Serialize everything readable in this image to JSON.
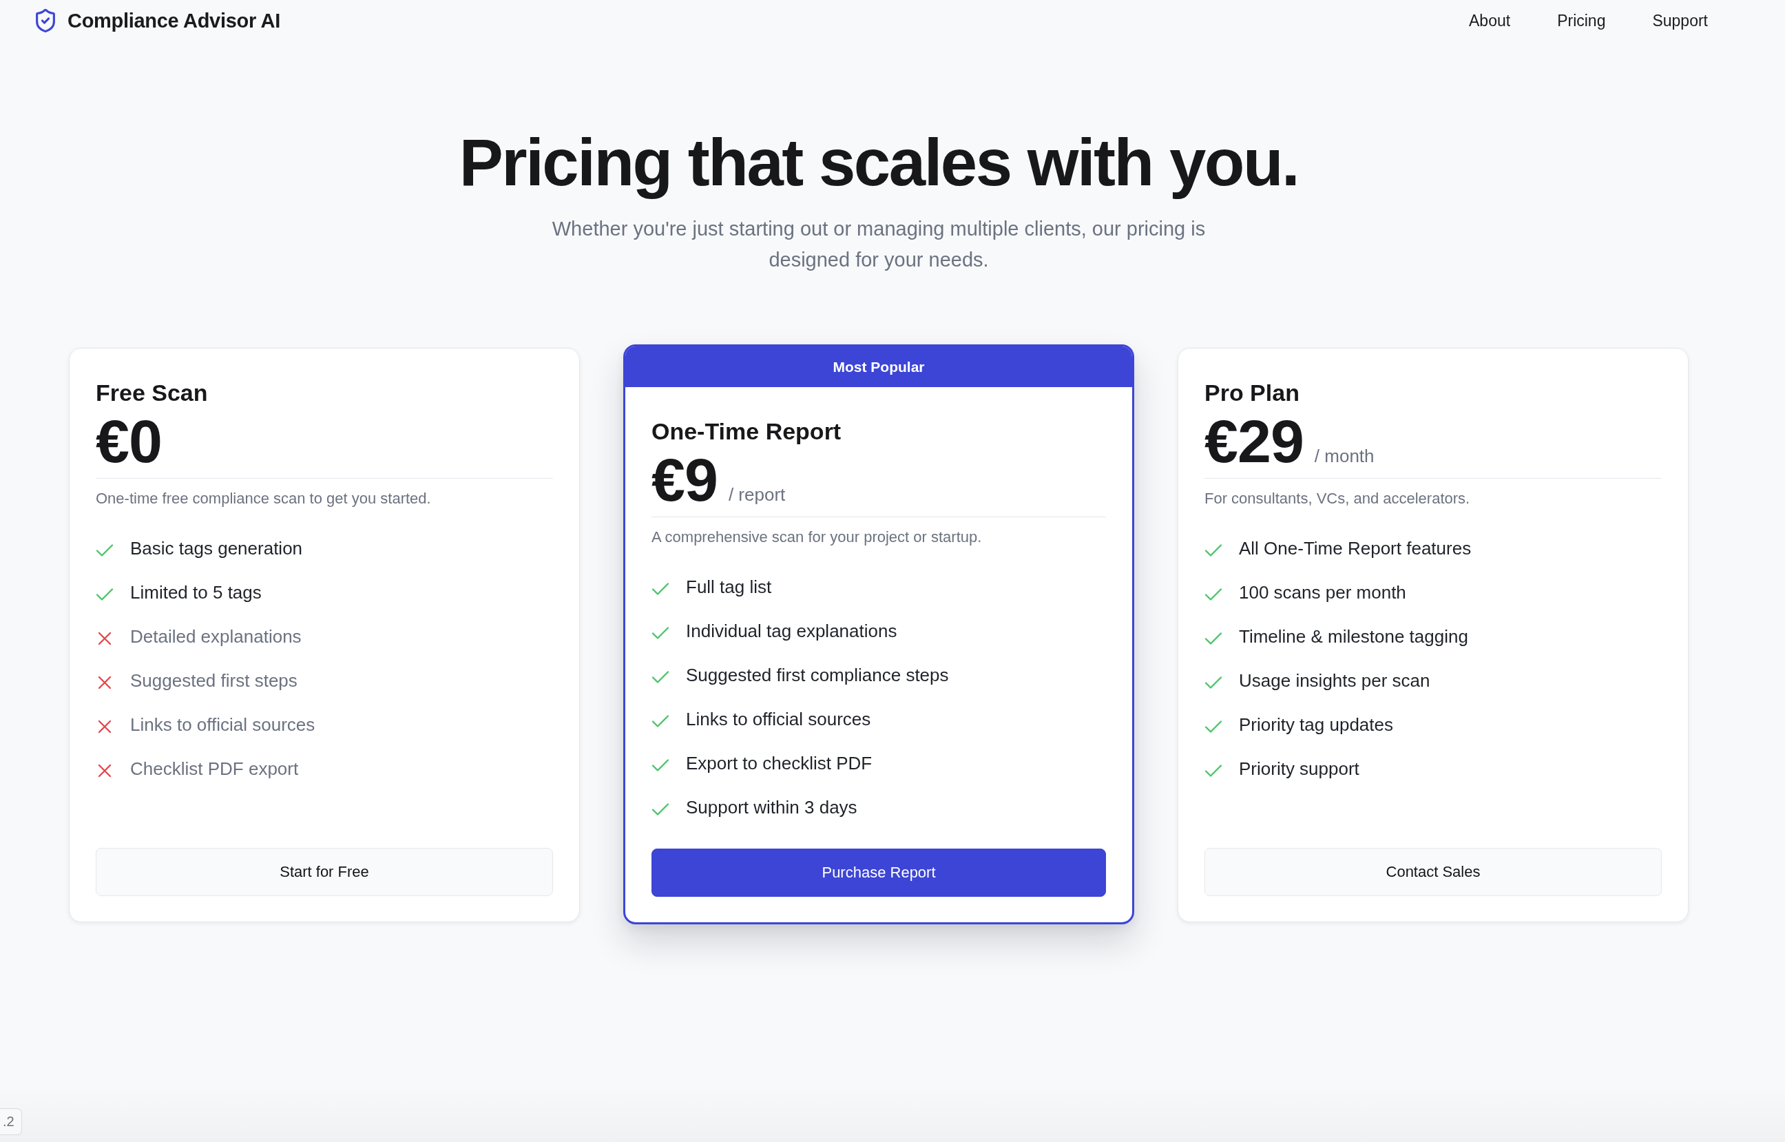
{
  "header": {
    "app_title": "Compliance Advisor AI",
    "nav": [
      "About",
      "Pricing",
      "Support"
    ]
  },
  "hero": {
    "title": "Pricing that scales with you.",
    "subtitle": "Whether you're just starting out or managing multiple clients, our pricing is designed for your needs."
  },
  "plans": [
    {
      "name": "Free Scan",
      "price": "€0",
      "description": "One-time free compliance scan to get you started.",
      "featured": false,
      "features": [
        {
          "text": "Basic tags generation",
          "included": true
        },
        {
          "text": "Limited to 5 tags",
          "included": true
        },
        {
          "text": "Detailed explanations",
          "included": false
        },
        {
          "text": "Suggested first steps",
          "included": false
        },
        {
          "text": "Links to official sources",
          "included": false
        },
        {
          "text": "Checklist PDF export",
          "included": false
        }
      ],
      "button": "Start for Free"
    },
    {
      "badge": "Most Popular",
      "name": "One-Time Report",
      "price": "€9",
      "period": "/ report",
      "description": "A comprehensive scan for your project or startup.",
      "featured": true,
      "features": [
        {
          "text": "Full tag list",
          "included": true
        },
        {
          "text": "Individual tag explanations",
          "included": true
        },
        {
          "text": "Suggested first compliance steps",
          "included": true
        },
        {
          "text": "Links to official sources",
          "included": true
        },
        {
          "text": "Export to checklist PDF",
          "included": true
        },
        {
          "text": "Support within 3 days",
          "included": true
        }
      ],
      "button": "Purchase Report"
    },
    {
      "name": "Pro Plan",
      "price": "€29",
      "period": "/ month",
      "description": "For consultants, VCs, and accelerators.",
      "featured": false,
      "features": [
        {
          "text": "All One-Time Report features",
          "included": true
        },
        {
          "text": "100 scans per month",
          "included": true
        },
        {
          "text": "Timeline & milestone tagging",
          "included": true
        },
        {
          "text": "Usage insights per scan",
          "included": true
        },
        {
          "text": "Priority tag updates",
          "included": true
        },
        {
          "text": "Priority support",
          "included": true
        }
      ],
      "button": "Contact Sales"
    }
  ],
  "version_badge": ".2"
}
